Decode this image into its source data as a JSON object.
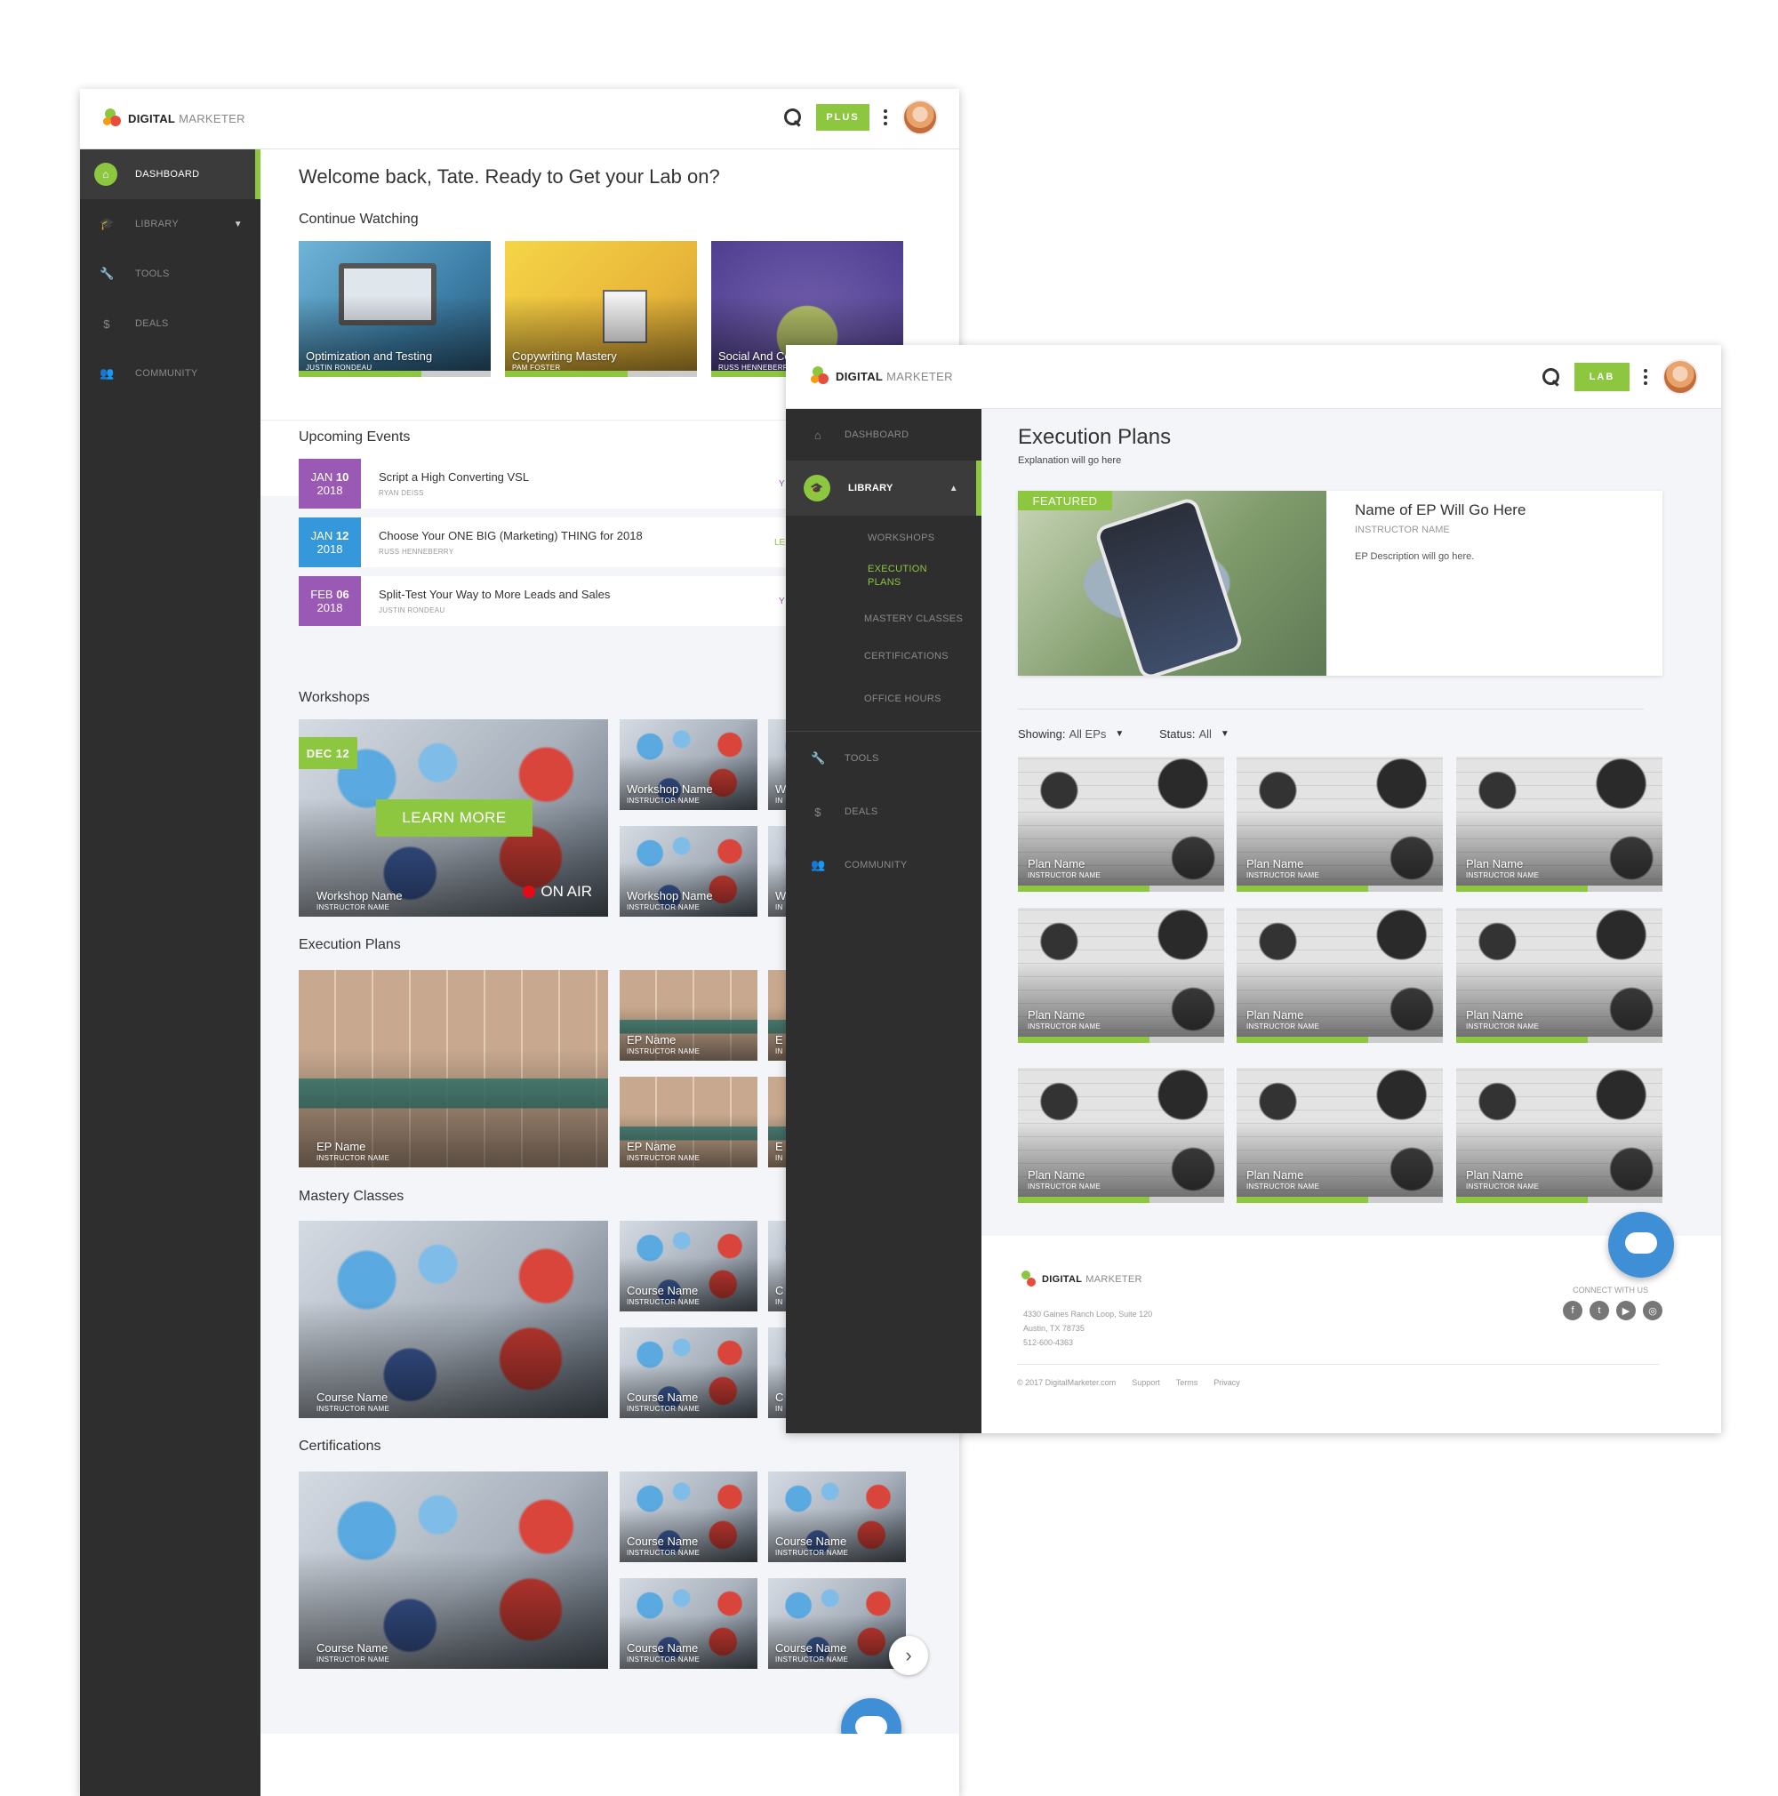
{
  "w1": {
    "logo": {
      "bold": "DIGITAL",
      "light": "MARKETER"
    },
    "badge": "PLUS",
    "nav": [
      {
        "label": "DASHBOARD",
        "icon": "home-icon"
      },
      {
        "label": "LIBRARY",
        "icon": "graduation-cap-icon"
      },
      {
        "label": "TOOLS",
        "icon": "wrench-icon"
      },
      {
        "label": "DEALS",
        "icon": "dollar-icon"
      },
      {
        "label": "COMMUNITY",
        "icon": "users-icon"
      }
    ],
    "welcome": "Welcome back, Tate. Ready to Get your Lab on?",
    "continue": {
      "title": "Continue Watching",
      "items": [
        {
          "title": "Optimization and Testing",
          "author": "JUSTIN RONDEAU",
          "progress": 0.64
        },
        {
          "title": "Copywriting Mastery",
          "author": "PAM FOSTER",
          "progress": 0.64
        },
        {
          "title": "Social And Community",
          "author": "RUSS HENNEBERRY",
          "progress": 0.64
        }
      ]
    },
    "events": {
      "title": "Upcoming Events",
      "items": [
        {
          "mon": "JAN",
          "day": "10",
          "year": "2018",
          "title": "Script a High Converting VSL",
          "author": "RYAN DEISS",
          "color": "#9b59b6",
          "tag": "Y"
        },
        {
          "mon": "JAN",
          "day": "12",
          "year": "2018",
          "title": "Choose Your ONE BIG (Marketing) THING for 2018",
          "author": "RUSS HENNEBERRY",
          "color": "#3498db",
          "tag": "LE"
        },
        {
          "mon": "FEB",
          "day": "06",
          "year": "2018",
          "title": "Split-Test Your Way to More Leads and Sales",
          "author": "JUSTIN RONDEAU",
          "color": "#9b59b6",
          "tag": "Y"
        }
      ]
    },
    "workshops": {
      "title": "Workshops",
      "date": "DEC 12",
      "cta": "LEARN MORE",
      "live": "ON AIR",
      "big": {
        "name": "Workshop Name",
        "inst": "INSTRUCTOR NAME"
      },
      "small": [
        {
          "name": "Workshop Name",
          "inst": "INSTRUCTOR NAME"
        },
        {
          "name": "Workshop Name",
          "inst": "INSTRUCTOR NAME"
        },
        {
          "name": "W",
          "inst": "IN"
        },
        {
          "name": "W",
          "inst": "IN"
        }
      ]
    },
    "eps": {
      "title": "Execution Plans",
      "big": {
        "name": "EP Name",
        "inst": "INSTRUCTOR NAME"
      },
      "small": [
        {
          "name": "EP Name",
          "inst": "INSTRUCTOR NAME"
        },
        {
          "name": "EP Name",
          "inst": "INSTRUCTOR NAME"
        },
        {
          "name": "E",
          "inst": "IN"
        },
        {
          "name": "E",
          "inst": "IN"
        }
      ]
    },
    "mastery": {
      "title": "Mastery Classes",
      "big": {
        "name": "Course Name",
        "inst": "INSTRUCTOR NAME"
      },
      "small": [
        {
          "name": "Course Name",
          "inst": "INSTRUCTOR NAME"
        },
        {
          "name": "Course Name",
          "inst": "INSTRUCTOR NAME"
        },
        {
          "name": "C",
          "inst": "IN"
        },
        {
          "name": "C",
          "inst": "IN"
        }
      ]
    },
    "certs": {
      "title": "Certifications",
      "big": {
        "name": "Course Name",
        "inst": "INSTRUCTOR NAME"
      },
      "small": [
        {
          "name": "Course Name",
          "inst": "INSTRUCTOR NAME"
        },
        {
          "name": "Course Name",
          "inst": "INSTRUCTOR NAME"
        },
        {
          "name": "Course Name",
          "inst": "INSTRUCTOR NAME"
        },
        {
          "name": "Course Name",
          "inst": "INSTRUCTOR NAME"
        }
      ]
    }
  },
  "w2": {
    "badge": "LAB",
    "nav": {
      "dashboard": "DASHBOARD",
      "library": "LIBRARY",
      "sub": [
        "WORKSHOPS",
        "EXECUTION PLANS",
        "MASTERY CLASSES",
        "CERTIFICATIONS",
        "OFFICE HOURS"
      ],
      "tools": "TOOLS",
      "deals": "DEALS",
      "community": "COMMUNITY"
    },
    "title": "Execution Plans",
    "subtitle": "Explanation will go here",
    "featured": {
      "badge": "FEATURED",
      "name": "Name of EP Will Go Here",
      "inst": "INSTRUCTOR NAME",
      "desc": "EP Description will go here."
    },
    "filters": {
      "showing_label": "Showing:",
      "showing": "All EPs",
      "status_label": "Status:",
      "status": "All"
    },
    "plans": [
      {
        "name": "Plan Name",
        "inst": "INSTRUCTOR NAME",
        "progress": 0.64
      },
      {
        "name": "Plan Name",
        "inst": "INSTRUCTOR NAME",
        "progress": 0.64
      },
      {
        "name": "Plan Name",
        "inst": "INSTRUCTOR NAME",
        "progress": 0.64
      },
      {
        "name": "Plan Name",
        "inst": "INSTRUCTOR NAME",
        "progress": 0.64
      },
      {
        "name": "Plan Name",
        "inst": "INSTRUCTOR NAME",
        "progress": 0.64
      },
      {
        "name": "Plan Name",
        "inst": "INSTRUCTOR NAME",
        "progress": 0.64
      },
      {
        "name": "Plan Name",
        "inst": "INSTRUCTOR NAME",
        "progress": 0.64
      },
      {
        "name": "Plan Name",
        "inst": "INSTRUCTOR NAME",
        "progress": 0.64
      },
      {
        "name": "Plan Name",
        "inst": "INSTRUCTOR NAME",
        "progress": 0.64
      }
    ],
    "footer": {
      "addr1": "4330 Gaines Ranch Loop, Suite 120",
      "addr2": "Austin, TX 78735",
      "phone": "512-600-4363",
      "connect": "CONNECT WITH US",
      "copy": "© 2017 DigitalMarketer.com",
      "links": [
        "Support",
        "Terms",
        "Privacy"
      ],
      "social": [
        "facebook-icon",
        "twitter-icon",
        "youtube-icon",
        "instagram-icon"
      ]
    }
  },
  "colors": {
    "green": "#8dc63f",
    "sidebar": "#2e2e2e",
    "chat": "#3f8fd6"
  }
}
